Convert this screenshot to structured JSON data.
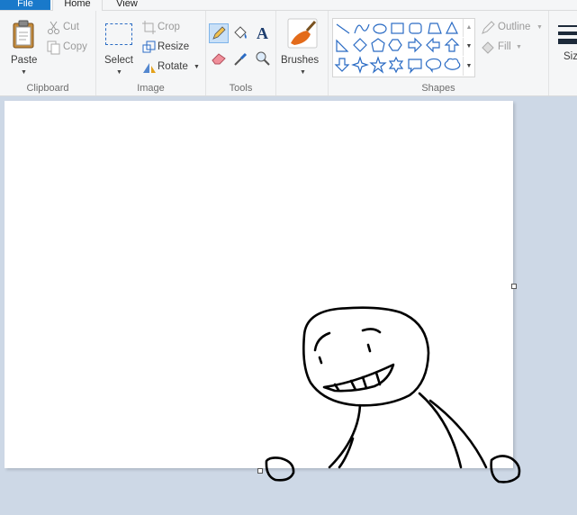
{
  "tabs": {
    "file": "File",
    "home": "Home",
    "view": "View"
  },
  "clipboard": {
    "paste": "Paste",
    "cut": "Cut",
    "copy": "Copy",
    "label": "Clipboard"
  },
  "image": {
    "select": "Select",
    "crop": "Crop",
    "resize": "Resize",
    "rotate": "Rotate",
    "label": "Image"
  },
  "tools": {
    "label": "Tools"
  },
  "brushes": {
    "label": "Brushes"
  },
  "shapes": {
    "outline": "Outline",
    "fill": "Fill",
    "label": "Shapes"
  },
  "size": {
    "label": "Size"
  },
  "colors": {
    "accent": "#1979ca",
    "shape_stroke": "#2a6bc4",
    "brush_orange": "#e36b1a"
  }
}
